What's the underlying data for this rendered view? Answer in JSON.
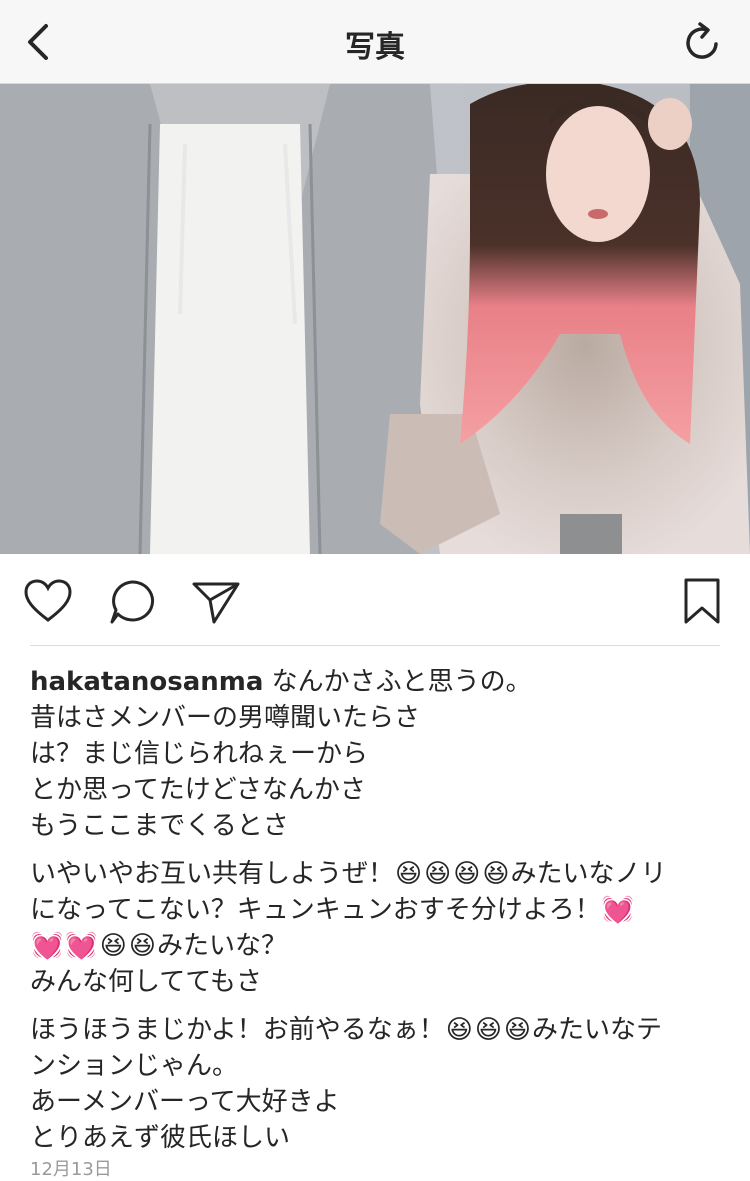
{
  "nav": {
    "title": "写真",
    "back_icon": "chevron-left-icon",
    "refresh_icon": "refresh-icon"
  },
  "photo": {
    "description_icon": "photo"
  },
  "actions": {
    "like_icon": "heart-icon",
    "comment_icon": "comment-icon",
    "share_icon": "send-icon",
    "save_icon": "bookmark-icon"
  },
  "caption": {
    "username": "hakatanosanma",
    "line1": "なんかさふと思うの。",
    "line2": "昔はさメンバーの男噂聞いたらさ",
    "line3": "は？まじ信じられねぇーから",
    "line4": "とか思ってたけどさなんかさ",
    "line5": "もうここまでくるとさ",
    "line6a": "いやいやお互い共有しようぜ！",
    "line6b": "みたいなノリ",
    "line7a": "になってこない？キュンキュンおすそ分けよろ！",
    "line8b": "みたいな？",
    "line9": "みんな何しててもさ",
    "line10a": "ほうほうまじかよ！お前やるなぁ！",
    "line10b": "みたいなテ",
    "line11": "ンションじゃん。",
    "line12": "あーメンバーって大好きよ",
    "line13": "とりあえず彼氏ほしい",
    "emoji_laugh": "😆",
    "emoji_heart": "💓"
  },
  "date": "12月13日",
  "colors": {
    "nav_bg": "#f7f7f7",
    "text": "#262626",
    "muted": "#9a9a9a",
    "hair_pink": "#f08a8f"
  }
}
